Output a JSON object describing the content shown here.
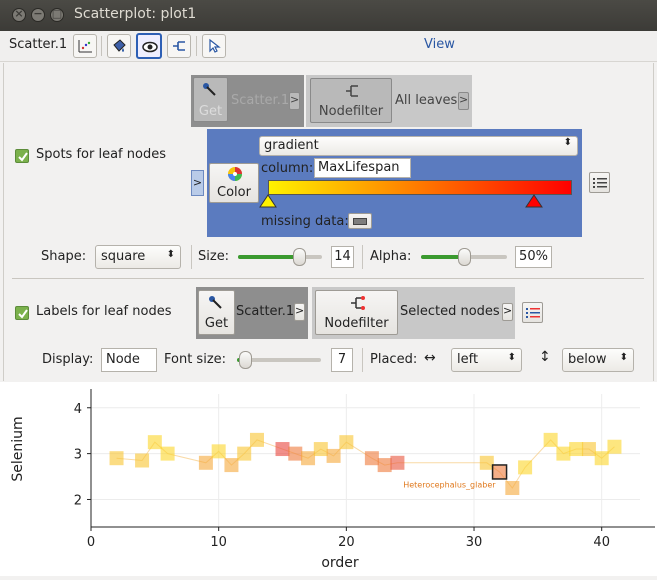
{
  "window": {
    "title": "Scatterplot: plot1"
  },
  "toolbar": {
    "scatter_label": "Scatter.1",
    "view_label": "View"
  },
  "spots": {
    "checkbox_label": "Spots for leaf nodes",
    "get_label": "Get",
    "get_target": "Scatter.1",
    "nodefilter_label": "Nodefilter",
    "filter_value": "All leaves",
    "color_button": "Color",
    "mode": "gradient",
    "column_label": "column:",
    "column_value": "MaxLifespan",
    "missing_label": "missing data:",
    "gradient_colors": [
      "#fff200",
      "#ff0000"
    ]
  },
  "shape_row": {
    "shape_label": "Shape:",
    "shape_value": "square",
    "size_label": "Size:",
    "size_value": "14",
    "size_fraction": 0.73,
    "alpha_label": "Alpha:",
    "alpha_value": "50%",
    "alpha_fraction": 0.5
  },
  "labels": {
    "checkbox_label": "Labels for leaf nodes",
    "get_label": "Get",
    "get_target": "Scatter.1",
    "nodefilter_label": "Nodefilter",
    "filter_value": "Selected nodes"
  },
  "display_row": {
    "display_label": "Display:",
    "display_value": "Node",
    "fontsize_label": "Font size:",
    "fontsize_value": "7",
    "fontsize_fraction": 0.1,
    "placed_label": "Placed:",
    "horiz_value": "left",
    "vert_value": "below"
  },
  "chart_data": {
    "type": "scatter",
    "xlabel": "order",
    "ylabel": "Selenium",
    "xlim": [
      0,
      43
    ],
    "ylim": [
      1.4,
      4.3
    ],
    "xticks": [
      0,
      10,
      20,
      30,
      40
    ],
    "yticks": [
      2,
      3,
      4
    ],
    "grid": true,
    "points": [
      {
        "x": 2,
        "y": 2.9,
        "c": "#f9c530"
      },
      {
        "x": 4,
        "y": 2.85,
        "c": "#f9c530"
      },
      {
        "x": 5,
        "y": 3.25,
        "c": "#fbd62a"
      },
      {
        "x": 6,
        "y": 3.0,
        "c": "#fbd62a"
      },
      {
        "x": 9,
        "y": 2.8,
        "c": "#f5a93a"
      },
      {
        "x": 10,
        "y": 3.05,
        "c": "#fbd62a"
      },
      {
        "x": 11,
        "y": 2.75,
        "c": "#f5a93a"
      },
      {
        "x": 12,
        "y": 3.0,
        "c": "#f9c530"
      },
      {
        "x": 13,
        "y": 3.3,
        "c": "#f9c530"
      },
      {
        "x": 15,
        "y": 3.1,
        "c": "#e8453c"
      },
      {
        "x": 16,
        "y": 3.0,
        "c": "#ef7a3a"
      },
      {
        "x": 17,
        "y": 2.9,
        "c": "#f5a93a"
      },
      {
        "x": 18,
        "y": 3.1,
        "c": "#f9c530"
      },
      {
        "x": 19,
        "y": 2.95,
        "c": "#f5a93a"
      },
      {
        "x": 20,
        "y": 3.25,
        "c": "#f9c530"
      },
      {
        "x": 22,
        "y": 2.9,
        "c": "#ef7a3a"
      },
      {
        "x": 23,
        "y": 2.75,
        "c": "#ef7a3a"
      },
      {
        "x": 24,
        "y": 2.8,
        "c": "#e8553c"
      },
      {
        "x": 31,
        "y": 2.8,
        "c": "#f9c530"
      },
      {
        "x": 32,
        "y": 2.6,
        "c": "#ef7a3a",
        "selected": true
      },
      {
        "x": 33,
        "y": 2.25,
        "c": "#f5a93a"
      },
      {
        "x": 34,
        "y": 2.7,
        "c": "#fbd62a"
      },
      {
        "x": 36,
        "y": 3.3,
        "c": "#fbd62a"
      },
      {
        "x": 37,
        "y": 3.0,
        "c": "#fbd62a"
      },
      {
        "x": 38,
        "y": 3.1,
        "c": "#fbd62a"
      },
      {
        "x": 39,
        "y": 3.1,
        "c": "#f9c530"
      },
      {
        "x": 40,
        "y": 2.9,
        "c": "#fbd62a"
      },
      {
        "x": 41,
        "y": 3.15,
        "c": "#fbd62a"
      }
    ],
    "annotation": {
      "x": 32,
      "y": 2.35,
      "text": "Heterocephalus_glaber"
    }
  }
}
